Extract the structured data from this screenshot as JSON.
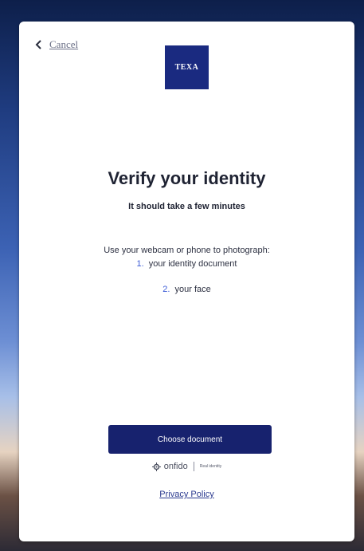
{
  "header": {
    "cancel_label": "Cancel",
    "logo_text": "TEXA"
  },
  "main": {
    "title": "Verify your identity",
    "subtitle": "It should take a few minutes",
    "instructions": "Use your webcam or phone to photograph:",
    "steps": [
      {
        "number": "1.",
        "text": "your identity document"
      },
      {
        "number": "2.",
        "text": "your face"
      }
    ]
  },
  "footer": {
    "primary_button_label": "Choose document",
    "brand_name": "onfido",
    "brand_tagline": "Real identity",
    "privacy_label": "Privacy Policy"
  },
  "colors": {
    "primary": "#17226e",
    "logo_bg": "#1a2a80",
    "step_number": "#3b5bd6"
  }
}
